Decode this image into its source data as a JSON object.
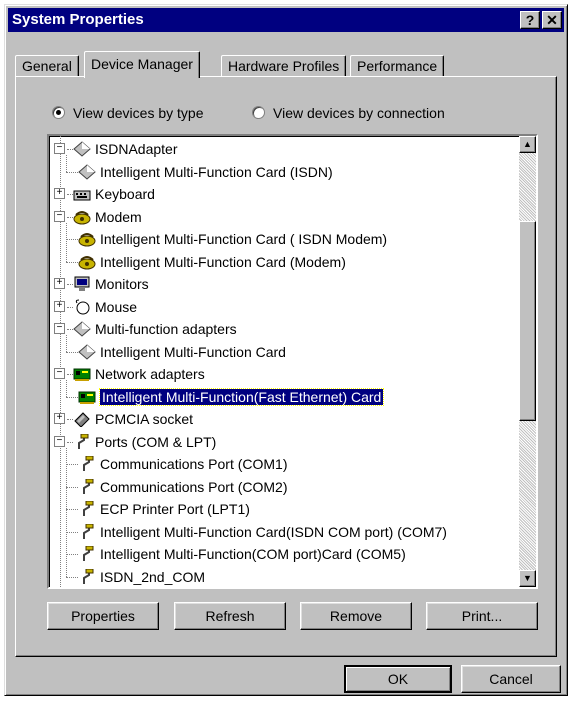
{
  "window": {
    "title": "System Properties",
    "help_label": "?",
    "close_label": "✕"
  },
  "tabs": [
    {
      "label": "General"
    },
    {
      "label": "Device Manager"
    },
    {
      "label": "Hardware Profiles"
    },
    {
      "label": "Performance"
    }
  ],
  "view_options": {
    "by_type": "View devices by type",
    "by_connection": "View devices by connection",
    "selected": "by_type"
  },
  "tree": [
    {
      "label": "ISDNAdapter",
      "expander": "−",
      "icon": "adapter-icon"
    },
    {
      "label": "Intelligent Multi-Function Card (ISDN)",
      "icon": "adapter-icon"
    },
    {
      "label": "Keyboard",
      "expander": "+",
      "icon": "keyboard-icon"
    },
    {
      "label": "Modem",
      "expander": "−",
      "icon": "modem-icon"
    },
    {
      "label": "Intelligent Multi-Function Card ( ISDN Modem)",
      "icon": "modem-icon"
    },
    {
      "label": "Intelligent Multi-Function Card (Modem)",
      "icon": "modem-icon"
    },
    {
      "label": "Monitors",
      "expander": "+",
      "icon": "monitor-icon"
    },
    {
      "label": "Mouse",
      "expander": "+",
      "icon": "mouse-icon"
    },
    {
      "label": "Multi-function adapters",
      "expander": "−",
      "icon": "adapter-icon"
    },
    {
      "label": "Intelligent  Multi-Function Card",
      "icon": "adapter-icon"
    },
    {
      "label": "Network adapters",
      "expander": "−",
      "icon": "network-card-icon"
    },
    {
      "label": "Intelligent Multi-Function(Fast Ethernet) Card",
      "icon": "network-card-icon",
      "selected": true
    },
    {
      "label": "PCMCIA socket",
      "expander": "+",
      "icon": "pcmcia-icon"
    },
    {
      "label": "Ports (COM & LPT)",
      "expander": "−",
      "icon": "port-icon"
    },
    {
      "label": "Communications Port (COM1)",
      "icon": "port-icon"
    },
    {
      "label": "Communications Port (COM2)",
      "icon": "port-icon"
    },
    {
      "label": "ECP Printer Port (LPT1)",
      "icon": "port-icon"
    },
    {
      "label": "Intelligent Multi-Function Card(ISDN COM port) (COM7)",
      "icon": "port-icon"
    },
    {
      "label": "Intelligent Multi-Function(COM port)Card (COM5)",
      "icon": "port-icon"
    },
    {
      "label": "ISDN_2nd_COM",
      "icon": "port-icon"
    }
  ],
  "panel_buttons": {
    "properties": "Properties",
    "refresh": "Refresh",
    "remove": "Remove",
    "print": "Print..."
  },
  "dialog_buttons": {
    "ok": "OK",
    "cancel": "Cancel"
  },
  "colors": {
    "title_bar": "#000080",
    "face": "#c0c0c0",
    "selection": "#000080"
  }
}
